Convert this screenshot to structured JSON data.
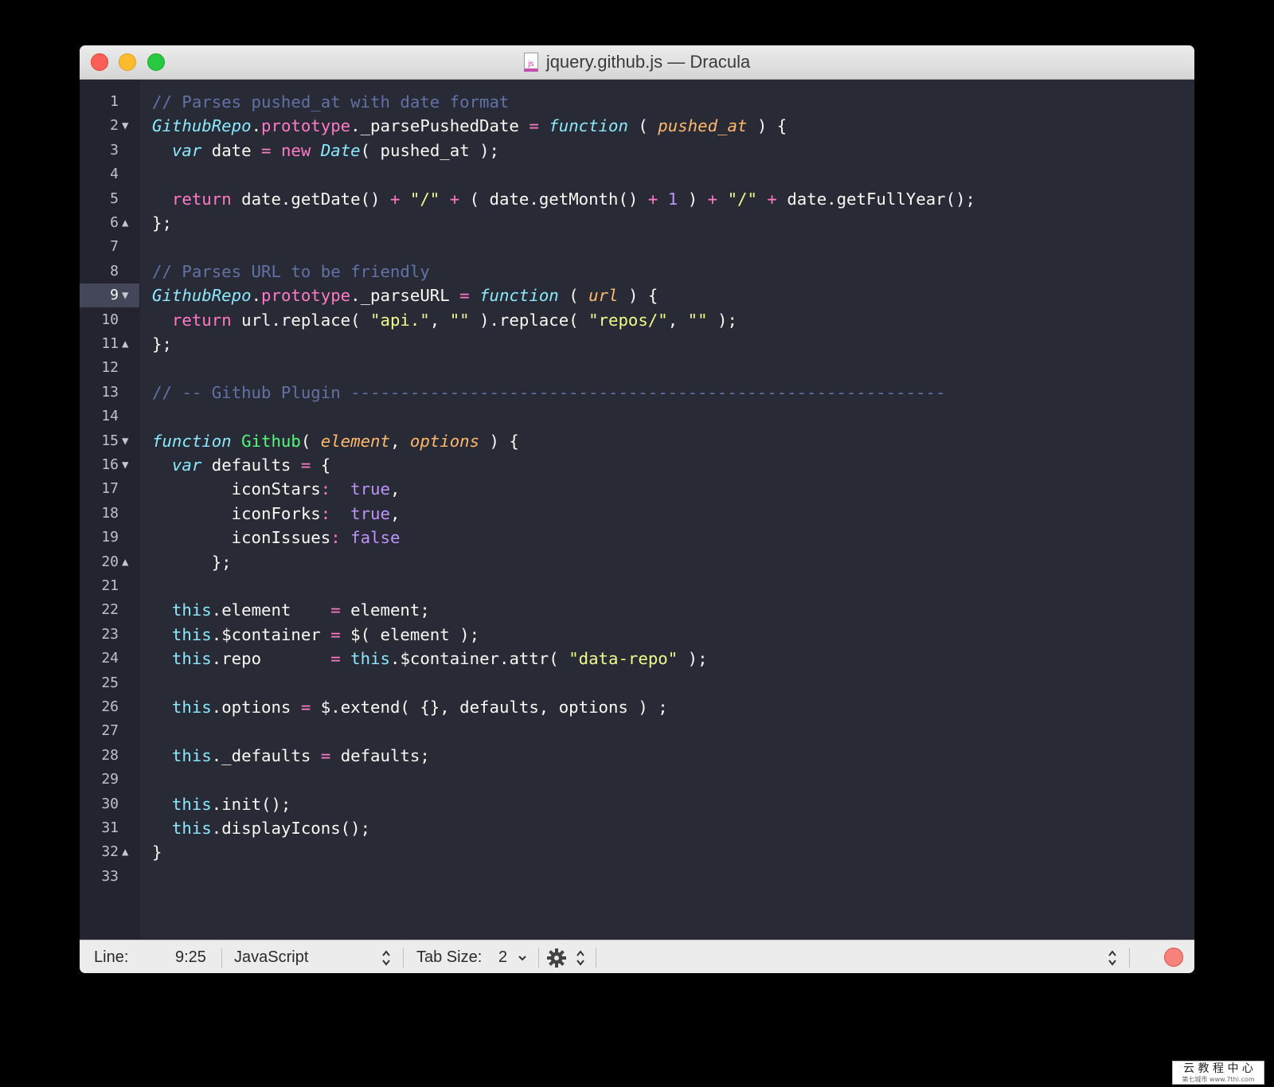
{
  "window": {
    "title": "jquery.github.js — Dracula",
    "file_icon_label": "js"
  },
  "colors": {
    "background": "#282a36",
    "foreground": "#f8f8f2",
    "comment": "#6272a4",
    "cyan": "#8be9fd",
    "green": "#50fa7b",
    "orange": "#ffb86c",
    "pink": "#ff79c6",
    "purple": "#bd93f9",
    "yellow": "#f1fa8c",
    "current_line": "#44475a"
  },
  "editor": {
    "current_line": 9,
    "lines": [
      {
        "n": "1",
        "fold": "",
        "tokens": [
          {
            "t": "// Parses pushed_at with date format",
            "c": "comment"
          }
        ]
      },
      {
        "n": "2",
        "fold": "down",
        "tokens": [
          {
            "t": "GithubRepo",
            "c": "cyan",
            "i": true
          },
          {
            "t": ".",
            "c": "fg"
          },
          {
            "t": "prototype",
            "c": "pink"
          },
          {
            "t": "._parsePushedDate ",
            "c": "fg"
          },
          {
            "t": "=",
            "c": "pink"
          },
          {
            "t": " ",
            "c": "fg"
          },
          {
            "t": "function",
            "c": "cyan",
            "i": true
          },
          {
            "t": " ( ",
            "c": "fg"
          },
          {
            "t": "pushed_at",
            "c": "orange",
            "i": true
          },
          {
            "t": " ) {",
            "c": "fg"
          }
        ]
      },
      {
        "n": "3",
        "fold": "",
        "tokens": [
          {
            "t": "  ",
            "c": "fg"
          },
          {
            "t": "var",
            "c": "cyan",
            "i": true
          },
          {
            "t": " date ",
            "c": "fg"
          },
          {
            "t": "=",
            "c": "pink"
          },
          {
            "t": " ",
            "c": "fg"
          },
          {
            "t": "new",
            "c": "pink"
          },
          {
            "t": " ",
            "c": "fg"
          },
          {
            "t": "Date",
            "c": "cyan",
            "i": true
          },
          {
            "t": "( pushed_at );",
            "c": "fg"
          }
        ]
      },
      {
        "n": "4",
        "fold": "",
        "tokens": []
      },
      {
        "n": "5",
        "fold": "",
        "tokens": [
          {
            "t": "  ",
            "c": "fg"
          },
          {
            "t": "return",
            "c": "pink"
          },
          {
            "t": " date.getDate() ",
            "c": "fg"
          },
          {
            "t": "+",
            "c": "pink"
          },
          {
            "t": " ",
            "c": "fg"
          },
          {
            "t": "\"/\"",
            "c": "yellow"
          },
          {
            "t": " ",
            "c": "fg"
          },
          {
            "t": "+",
            "c": "pink"
          },
          {
            "t": " ( date.getMonth() ",
            "c": "fg"
          },
          {
            "t": "+",
            "c": "pink"
          },
          {
            "t": " ",
            "c": "fg"
          },
          {
            "t": "1",
            "c": "purple"
          },
          {
            "t": " ) ",
            "c": "fg"
          },
          {
            "t": "+",
            "c": "pink"
          },
          {
            "t": " ",
            "c": "fg"
          },
          {
            "t": "\"/\"",
            "c": "yellow"
          },
          {
            "t": " ",
            "c": "fg"
          },
          {
            "t": "+",
            "c": "pink"
          },
          {
            "t": " date.getFullYear();",
            "c": "fg"
          }
        ]
      },
      {
        "n": "6",
        "fold": "up",
        "tokens": [
          {
            "t": "};",
            "c": "fg"
          }
        ]
      },
      {
        "n": "7",
        "fold": "",
        "tokens": []
      },
      {
        "n": "8",
        "fold": "",
        "tokens": [
          {
            "t": "// Parses URL to be friendly",
            "c": "comment"
          }
        ]
      },
      {
        "n": "9",
        "fold": "down",
        "tokens": [
          {
            "t": "GithubRepo",
            "c": "cyan",
            "i": true
          },
          {
            "t": ".",
            "c": "fg"
          },
          {
            "t": "prototype",
            "c": "pink"
          },
          {
            "t": "._parseURL ",
            "c": "fg"
          },
          {
            "t": "=",
            "c": "pink"
          },
          {
            "t": " ",
            "c": "fg"
          },
          {
            "t": "function",
            "c": "cyan",
            "i": true
          },
          {
            "t": " ( ",
            "c": "fg"
          },
          {
            "t": "url",
            "c": "orange",
            "i": true
          },
          {
            "t": " ) {",
            "c": "fg"
          }
        ]
      },
      {
        "n": "10",
        "fold": "",
        "tokens": [
          {
            "t": "  ",
            "c": "fg"
          },
          {
            "t": "return",
            "c": "pink"
          },
          {
            "t": " url.replace( ",
            "c": "fg"
          },
          {
            "t": "\"api.\"",
            "c": "yellow"
          },
          {
            "t": ", ",
            "c": "fg"
          },
          {
            "t": "\"\"",
            "c": "yellow"
          },
          {
            "t": " ).replace( ",
            "c": "fg"
          },
          {
            "t": "\"repos/\"",
            "c": "yellow"
          },
          {
            "t": ", ",
            "c": "fg"
          },
          {
            "t": "\"\"",
            "c": "yellow"
          },
          {
            "t": " );",
            "c": "fg"
          }
        ]
      },
      {
        "n": "11",
        "fold": "up",
        "tokens": [
          {
            "t": "};",
            "c": "fg"
          }
        ]
      },
      {
        "n": "12",
        "fold": "",
        "tokens": []
      },
      {
        "n": "13",
        "fold": "",
        "tokens": [
          {
            "t": "// -- Github Plugin ------------------------------------------------------------",
            "c": "comment"
          }
        ]
      },
      {
        "n": "14",
        "fold": "",
        "tokens": []
      },
      {
        "n": "15",
        "fold": "down",
        "tokens": [
          {
            "t": "function",
            "c": "cyan",
            "i": true
          },
          {
            "t": " ",
            "c": "fg"
          },
          {
            "t": "Github",
            "c": "green"
          },
          {
            "t": "( ",
            "c": "fg"
          },
          {
            "t": "element",
            "c": "orange",
            "i": true
          },
          {
            "t": ", ",
            "c": "fg"
          },
          {
            "t": "options",
            "c": "orange",
            "i": true
          },
          {
            "t": " ) {",
            "c": "fg"
          }
        ]
      },
      {
        "n": "16",
        "fold": "down",
        "tokens": [
          {
            "t": "  ",
            "c": "fg"
          },
          {
            "t": "var",
            "c": "cyan",
            "i": true
          },
          {
            "t": " defaults ",
            "c": "fg"
          },
          {
            "t": "=",
            "c": "pink"
          },
          {
            "t": " {",
            "c": "fg"
          }
        ]
      },
      {
        "n": "17",
        "fold": "",
        "tokens": [
          {
            "t": "        iconStars",
            "c": "fg"
          },
          {
            "t": ":",
            "c": "pink"
          },
          {
            "t": "  ",
            "c": "fg"
          },
          {
            "t": "true",
            "c": "purple"
          },
          {
            "t": ",",
            "c": "fg"
          }
        ]
      },
      {
        "n": "18",
        "fold": "",
        "tokens": [
          {
            "t": "        iconForks",
            "c": "fg"
          },
          {
            "t": ":",
            "c": "pink"
          },
          {
            "t": "  ",
            "c": "fg"
          },
          {
            "t": "true",
            "c": "purple"
          },
          {
            "t": ",",
            "c": "fg"
          }
        ]
      },
      {
        "n": "19",
        "fold": "",
        "tokens": [
          {
            "t": "        iconIssues",
            "c": "fg"
          },
          {
            "t": ":",
            "c": "pink"
          },
          {
            "t": " ",
            "c": "fg"
          },
          {
            "t": "false",
            "c": "purple"
          }
        ]
      },
      {
        "n": "20",
        "fold": "up",
        "tokens": [
          {
            "t": "      };",
            "c": "fg"
          }
        ]
      },
      {
        "n": "21",
        "fold": "",
        "tokens": []
      },
      {
        "n": "22",
        "fold": "",
        "tokens": [
          {
            "t": "  ",
            "c": "fg"
          },
          {
            "t": "this",
            "c": "cyan"
          },
          {
            "t": ".element    ",
            "c": "fg"
          },
          {
            "t": "=",
            "c": "pink"
          },
          {
            "t": " element;",
            "c": "fg"
          }
        ]
      },
      {
        "n": "23",
        "fold": "",
        "tokens": [
          {
            "t": "  ",
            "c": "fg"
          },
          {
            "t": "this",
            "c": "cyan"
          },
          {
            "t": ".$container ",
            "c": "fg"
          },
          {
            "t": "=",
            "c": "pink"
          },
          {
            "t": " $( element );",
            "c": "fg"
          }
        ]
      },
      {
        "n": "24",
        "fold": "",
        "tokens": [
          {
            "t": "  ",
            "c": "fg"
          },
          {
            "t": "this",
            "c": "cyan"
          },
          {
            "t": ".repo       ",
            "c": "fg"
          },
          {
            "t": "=",
            "c": "pink"
          },
          {
            "t": " ",
            "c": "fg"
          },
          {
            "t": "this",
            "c": "cyan"
          },
          {
            "t": ".$container.attr( ",
            "c": "fg"
          },
          {
            "t": "\"data-repo\"",
            "c": "yellow"
          },
          {
            "t": " );",
            "c": "fg"
          }
        ]
      },
      {
        "n": "25",
        "fold": "",
        "tokens": []
      },
      {
        "n": "26",
        "fold": "",
        "tokens": [
          {
            "t": "  ",
            "c": "fg"
          },
          {
            "t": "this",
            "c": "cyan"
          },
          {
            "t": ".options ",
            "c": "fg"
          },
          {
            "t": "=",
            "c": "pink"
          },
          {
            "t": " $.extend( {}, defaults, options ) ;",
            "c": "fg"
          }
        ]
      },
      {
        "n": "27",
        "fold": "",
        "tokens": []
      },
      {
        "n": "28",
        "fold": "",
        "tokens": [
          {
            "t": "  ",
            "c": "fg"
          },
          {
            "t": "this",
            "c": "cyan"
          },
          {
            "t": "._defaults ",
            "c": "fg"
          },
          {
            "t": "=",
            "c": "pink"
          },
          {
            "t": " defaults;",
            "c": "fg"
          }
        ]
      },
      {
        "n": "29",
        "fold": "",
        "tokens": []
      },
      {
        "n": "30",
        "fold": "",
        "tokens": [
          {
            "t": "  ",
            "c": "fg"
          },
          {
            "t": "this",
            "c": "cyan"
          },
          {
            "t": ".init();",
            "c": "fg"
          }
        ]
      },
      {
        "n": "31",
        "fold": "",
        "tokens": [
          {
            "t": "  ",
            "c": "fg"
          },
          {
            "t": "this",
            "c": "cyan"
          },
          {
            "t": ".displayIcons();",
            "c": "fg"
          }
        ]
      },
      {
        "n": "32",
        "fold": "up",
        "tokens": [
          {
            "t": "}",
            "c": "fg"
          }
        ]
      },
      {
        "n": "33",
        "fold": "",
        "tokens": []
      }
    ]
  },
  "statusbar": {
    "line_label": "Line:",
    "line_value": "9:25",
    "language": "JavaScript",
    "tab_size_label": "Tab Size:",
    "tab_size_value": "2"
  },
  "watermark": {
    "line1": "云 教 程 中 心",
    "line2": "第七城市  www.7thi.com"
  }
}
